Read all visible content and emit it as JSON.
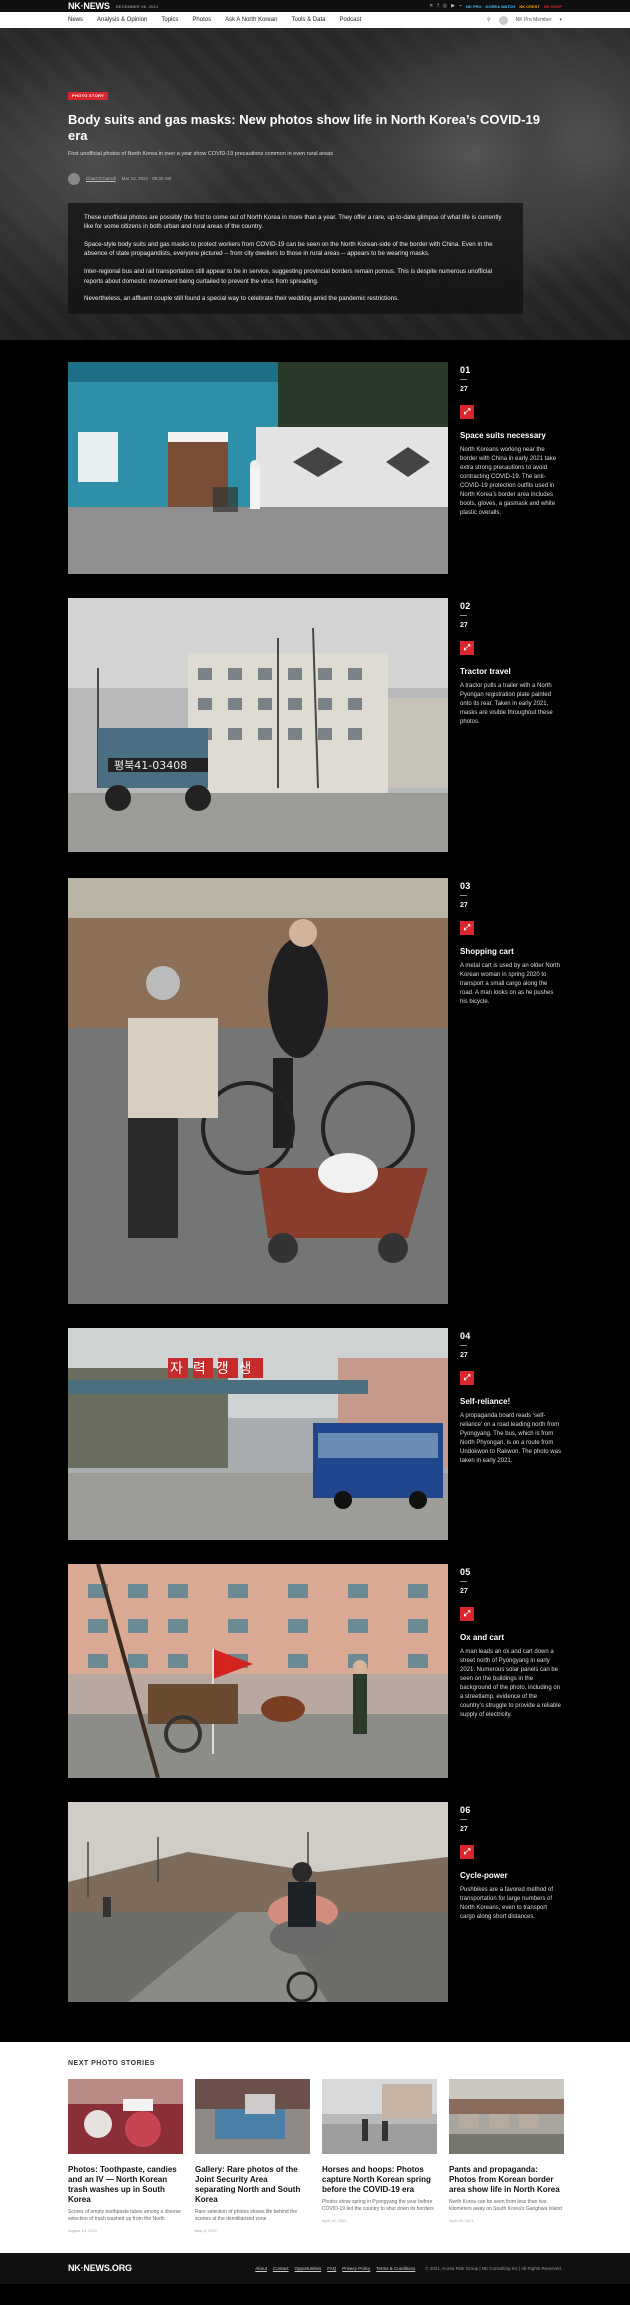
{
  "topbar": {
    "logo_nk": "NK",
    "logo_news": "NEWS",
    "date": "DECEMBER 06, 2021",
    "links": [
      "NK PRO",
      "KOREA WATCH",
      "NK CREST",
      "NK SHOP"
    ],
    "link_colors": [
      "#3dc1ff",
      "#3dc1ff",
      "#ff9c00",
      "#d8262c"
    ]
  },
  "nav": {
    "items": [
      "News",
      "Analysis & Opinion",
      "Topics",
      "Photos",
      "Ask A North Korean",
      "Tools & Data",
      "Podcast"
    ],
    "user": "NK Pro Member"
  },
  "hero": {
    "badge": "PHOTO STORY",
    "title": "Body suits and gas masks: New photos show life in North Korea’s COVID-19 era",
    "subtitle": "First unofficial photos of North Korea in over a year show COVID-19 precautions common in even rural areas",
    "author": "Chad O'Carroll",
    "published": "Mar 13, 2021 · 05:32 AM",
    "intro": [
      "These unofficial photos are possibly the first to come out of North Korea in more than a year. They offer a rare, up-to-date glimpse of what life is currently like for some citizens in both urban and rural areas of the country.",
      "Space-style body suits and gas masks to protect workers from COVID-19 can be seen on the North Korean-side of the border with China. Even in the absence of state propagandists, everyone pictured -- from city dwellers to those in rural areas -- appears to be wearing masks.",
      "Inter-regional bus and rail transportation still appear to be in service, suggesting provincial borders remain porous. This is despite numerous unofficial reports about domestic movement being curtailed to prevent the virus from spreading.",
      "Nevertheless, an affluent couple still found a special way to celebrate their wedding amid the pandemic restrictions."
    ]
  },
  "gallery": {
    "total": "27",
    "entries": [
      {
        "num": "01",
        "title": "Space suits necessary",
        "text": "North Koreans working near the border with China in early 2021 take extra strong precautions to avoid contracting COVID-19. The anti-COVID-19 protection outfits used in North Korea’s border area includes boots, gloves, a gasmask and white plastic overalls."
      },
      {
        "num": "02",
        "title": "Tractor travel",
        "text": "A tractor pulls a trailer with a North Pyongan registration plate painted onto its rear. Taken in early 2021, masks are visible throughout these photos.",
        "plate": "평북41-03408"
      },
      {
        "num": "03",
        "title": "Shopping cart",
        "text": "A metal cart is used by an older North Korean woman in spring 2020 to transport a small cargo along the road. A man looks on as he pushes his bicycle."
      },
      {
        "num": "04",
        "title": "Self-reliance!",
        "text": "A propaganda board reads ‘self-reliance’ on a road leading north from Pyongyang. The bus, which is from North Phyongan, is on a route from Undokwon to Rakwon. The photo was taken in early 2021.",
        "sign": "자력갱생"
      },
      {
        "num": "05",
        "title": "Ox and cart",
        "text": "A man leads an ox and cart down a street north of Pyongyang in early 2021. Numerous solar panels can be seen on the buildings in the background of the photo, including on a streetlamp, evidence of the country’s struggle to provide a reliable supply of electricity."
      },
      {
        "num": "06",
        "title": "Cycle-power",
        "text": "Pushbikes are a favored method of transportation for large numbers of North Koreans, even to transport cargo along short distances."
      }
    ]
  },
  "next": {
    "heading": "NEXT PHOTO STORIES",
    "stories": [
      {
        "title": "Photos: Toothpaste, candies and an IV — North Korean trash washes up in South Korea",
        "desc": "Scores of empty toothpaste tubes among a diverse selection of trash washed up from the North",
        "date": "August 13, 2021"
      },
      {
        "title": "Gallery: Rare photos of the Joint Security Area separating North and South Korea",
        "desc": "Rare selection of photos shows life behind the scenes at the demilitarized zone",
        "date": "May 6, 2021"
      },
      {
        "title": "Horses and hoops: Photos capture North Korean spring before the COVID-19 era",
        "desc": "Photos show spring in Pyongyang the year before COVID-19 led the country to shut down its borders",
        "date": "April 18, 2021"
      },
      {
        "title": "Pants and propaganda: Photos from Korean border area show life in North Korea",
        "desc": "North Korea can be seen from less than two kilometers away on South Korea's Ganghwa Island",
        "date": "April 08, 2021"
      }
    ]
  },
  "footer": {
    "links": [
      "About",
      "Contact",
      "Opportunities",
      "FAQ",
      "Privacy Policy",
      "Terms & Conditions"
    ],
    "copyright": "© 2021, Korea Risk Group | NK Consulting Inc | All Rights Reserved."
  }
}
